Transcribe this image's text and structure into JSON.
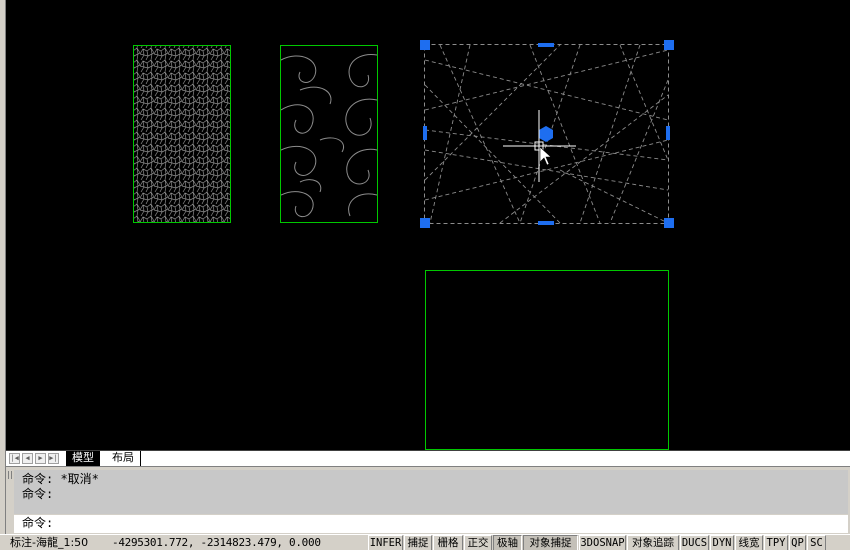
{
  "tabs": {
    "model": "模型",
    "layout": "布局",
    "nav_icons": [
      "first-icon",
      "prev-icon",
      "next-icon",
      "last-icon"
    ]
  },
  "command": {
    "history": [
      "命令: *取消*",
      "命令:"
    ],
    "prompt": "命令:"
  },
  "status": {
    "scale": "标注-海龍_1:50",
    "coords": "-4295301.772, -2314823.479, 0.000",
    "buttons": [
      {
        "id": "infer",
        "label": "INFER",
        "on": false
      },
      {
        "id": "snap",
        "label": "捕捉",
        "on": false
      },
      {
        "id": "grid",
        "label": "栅格",
        "on": false
      },
      {
        "id": "ortho",
        "label": "正交",
        "on": false
      },
      {
        "id": "polar",
        "label": "极轴",
        "on": true
      },
      {
        "id": "osnap",
        "label": "对象捕捉",
        "on": true
      },
      {
        "id": "3dosnap",
        "label": "3DOSNAP",
        "on": false
      },
      {
        "id": "otrack",
        "label": "对象追踪",
        "on": false
      },
      {
        "id": "ducs",
        "label": "DUCS",
        "on": false
      },
      {
        "id": "dyn",
        "label": "DYN",
        "on": false
      },
      {
        "id": "lwt",
        "label": "线宽",
        "on": false
      },
      {
        "id": "tpy",
        "label": "TPY",
        "on": false
      },
      {
        "id": "qp",
        "label": "QP",
        "on": false
      },
      {
        "id": "sc",
        "label": "SC",
        "on": false
      }
    ]
  },
  "colors": {
    "canvas_bg": "#000000",
    "rect_border": "#00c800",
    "pattern_line": "#8c8c8c",
    "grip_blue": "#1e6ef0",
    "crosshair": "#ffffff"
  }
}
